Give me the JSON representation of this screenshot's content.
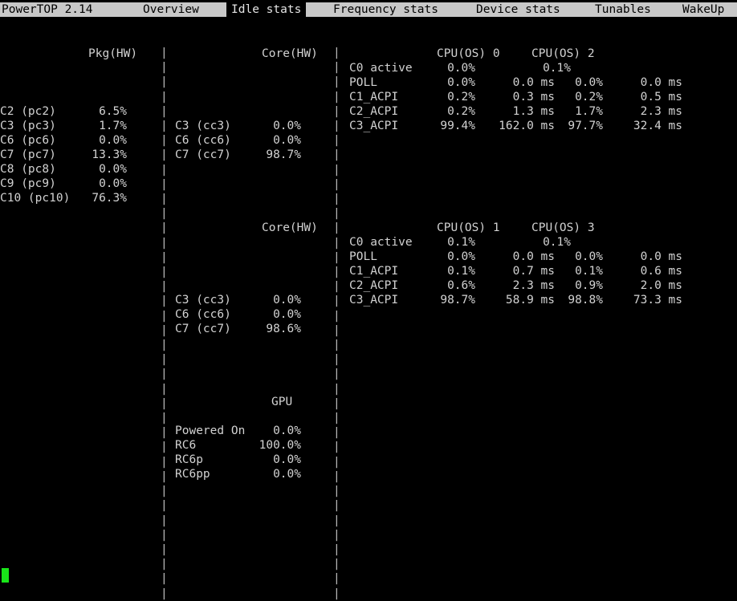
{
  "app": {
    "title": "PowerTOP 2.14"
  },
  "tabs": [
    "Overview",
    "Idle stats",
    "Frequency stats",
    "Device stats",
    "Tunables",
    "WakeUp"
  ],
  "active_tab": "Idle stats",
  "pkg": {
    "header": "Pkg(HW)",
    "rows": [
      {
        "state": "C2 (pc2)",
        "value": "6.5%"
      },
      {
        "state": "C3 (pc3)",
        "value": "1.7%"
      },
      {
        "state": "C6 (pc6)",
        "value": "0.0%"
      },
      {
        "state": "C7 (pc7)",
        "value": "13.3%"
      },
      {
        "state": "C8 (pc8)",
        "value": "0.0%"
      },
      {
        "state": "C9 (pc9)",
        "value": "0.0%"
      },
      {
        "state": "C10 (pc10)",
        "value": "76.3%"
      }
    ]
  },
  "core_groups": [
    {
      "header": "Core(HW)",
      "core_rows": [
        {
          "state": "C3 (cc3)",
          "value": "0.0%"
        },
        {
          "state": "C6 (cc6)",
          "value": "0.0%"
        },
        {
          "state": "C7 (cc7)",
          "value": "98.7%"
        }
      ],
      "cpu_header_a": "CPU(OS) 0",
      "cpu_header_b": "CPU(OS) 2",
      "c0": {
        "label": "C0 active",
        "a": "0.0%",
        "b": "0.1%"
      },
      "cpu_rows": [
        {
          "state": "POLL",
          "a_pct": "0.0%",
          "a_time": "0.0 ms",
          "b_pct": "0.0%",
          "b_time": "0.0 ms"
        },
        {
          "state": "C1_ACPI",
          "a_pct": "0.2%",
          "a_time": "0.3 ms",
          "b_pct": "0.2%",
          "b_time": "0.5 ms"
        },
        {
          "state": "C2_ACPI",
          "a_pct": "0.2%",
          "a_time": "1.3 ms",
          "b_pct": "1.7%",
          "b_time": "2.3 ms"
        },
        {
          "state": "C3_ACPI",
          "a_pct": "99.4%",
          "a_time": "162.0 ms",
          "b_pct": "97.7%",
          "b_time": "32.4 ms"
        }
      ]
    },
    {
      "header": "Core(HW)",
      "core_rows": [
        {
          "state": "C3 (cc3)",
          "value": "0.0%"
        },
        {
          "state": "C6 (cc6)",
          "value": "0.0%"
        },
        {
          "state": "C7 (cc7)",
          "value": "98.6%"
        }
      ],
      "cpu_header_a": "CPU(OS) 1",
      "cpu_header_b": "CPU(OS) 3",
      "c0": {
        "label": "C0 active",
        "a": "0.1%",
        "b": "0.1%"
      },
      "cpu_rows": [
        {
          "state": "POLL",
          "a_pct": "0.0%",
          "a_time": "0.0 ms",
          "b_pct": "0.0%",
          "b_time": "0.0 ms"
        },
        {
          "state": "C1_ACPI",
          "a_pct": "0.1%",
          "a_time": "0.7 ms",
          "b_pct": "0.1%",
          "b_time": "0.6 ms"
        },
        {
          "state": "C2_ACPI",
          "a_pct": "0.6%",
          "a_time": "2.3 ms",
          "b_pct": "0.9%",
          "b_time": "2.0 ms"
        },
        {
          "state": "C3_ACPI",
          "a_pct": "98.7%",
          "a_time": "58.9 ms",
          "b_pct": "98.8%",
          "b_time": "73.3 ms"
        }
      ]
    }
  ],
  "gpu": {
    "header": "GPU",
    "rows": [
      {
        "state": "Powered On",
        "value": "0.0%"
      },
      {
        "state": "RC6",
        "value": "100.0%"
      },
      {
        "state": "RC6p",
        "value": "0.0%"
      },
      {
        "state": "RC6pp",
        "value": "0.0%"
      }
    ]
  },
  "colors": {
    "background": "#000000",
    "text": "#d2d2d2",
    "topbar": "#c8c8c8",
    "cursor": "#19e619"
  }
}
